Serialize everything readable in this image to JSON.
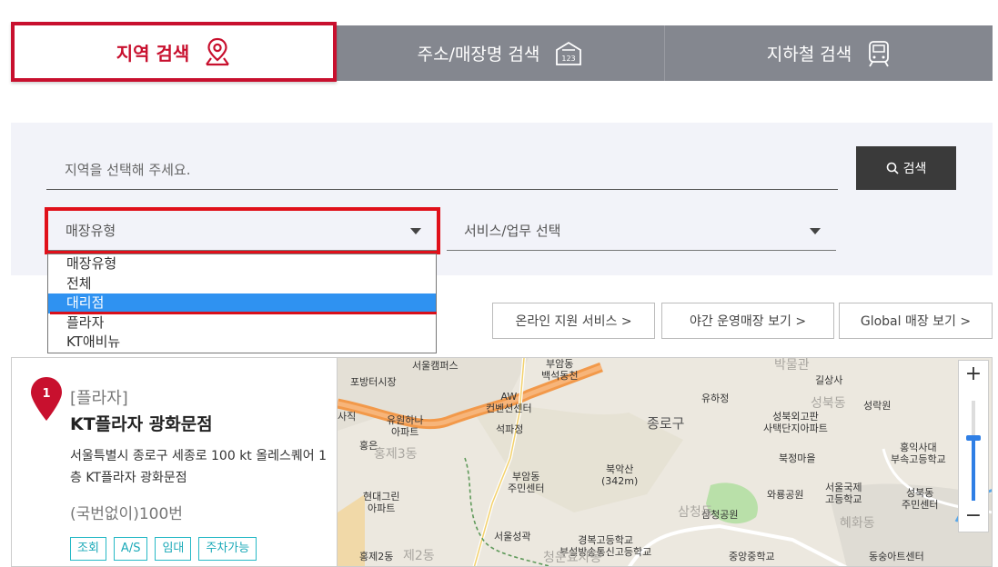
{
  "tabs": {
    "region": "지역 검색",
    "address": "주소/매장명 검색",
    "subway": "지하철 검색"
  },
  "search": {
    "placeholder": "지역을 선택해 주세요.",
    "button": "검색"
  },
  "filters": {
    "store_type": "매장유형",
    "service": "서비스/업무 선택"
  },
  "dropdown": {
    "options": [
      "매장유형",
      "전체",
      "대리점",
      "플라자",
      "KT애비뉴"
    ],
    "selected": "대리점"
  },
  "actions": {
    "online": "온라인 지원 서비스 >",
    "night": "야간 운영매장 보기 >",
    "global": "Global 매장 보기 >"
  },
  "result": {
    "index": "1",
    "type": "[플라자]",
    "name": "KT플라자 광화문점",
    "address": "서울특별시 종로구 세종로 100 kt 올레스퀘어 1층 KT플라자 광화문점",
    "jibun": "(국번없이)100번",
    "tags": [
      "조회",
      "A/S",
      "임대",
      "주차가능"
    ]
  },
  "map": {
    "labels": {
      "l1": "서울캠퍼스",
      "l2": "부암동\n백석동천",
      "l3": "포방터시장",
      "l4": "AW\n컨벤션센터",
      "l5": "유원하나\n아파트",
      "l6": "석파정",
      "l7": "홍은",
      "l8": "홍제3동",
      "l9": "부암동\n주민센터",
      "l10": "북악산\n(342m)",
      "l11": "종로구",
      "l12": "유하정",
      "l13": "성북외고판\n사택단지아파트",
      "l14": "길상사",
      "l15": "성락원",
      "l16": "성북동",
      "l17": "북정마을",
      "l18": "홍익사대\n부속고등학교",
      "l19": "와룡공원",
      "l20": "서울국제\n고등학교",
      "l21": "성북동\n주민센터",
      "l22": "현대그린\n아파트",
      "l23": "서울성곽",
      "l24": "삼청공원",
      "l25": "경복고등학교\n부설방송통신고등학교",
      "l26": "중앙중학교",
      "l27": "혜화동",
      "l28": "동숭아트센터",
      "l29": "홍제2동",
      "l30": "제2동",
      "l31": "박물관",
      "l32": "삼청동",
      "l33": "청운효자동",
      "l34": "사직"
    }
  },
  "colors": {
    "accent_red": "#c8102e",
    "tab_gray": "#84878f",
    "selected_blue": "#2f92f1",
    "tag_teal": "#27b9c6"
  }
}
